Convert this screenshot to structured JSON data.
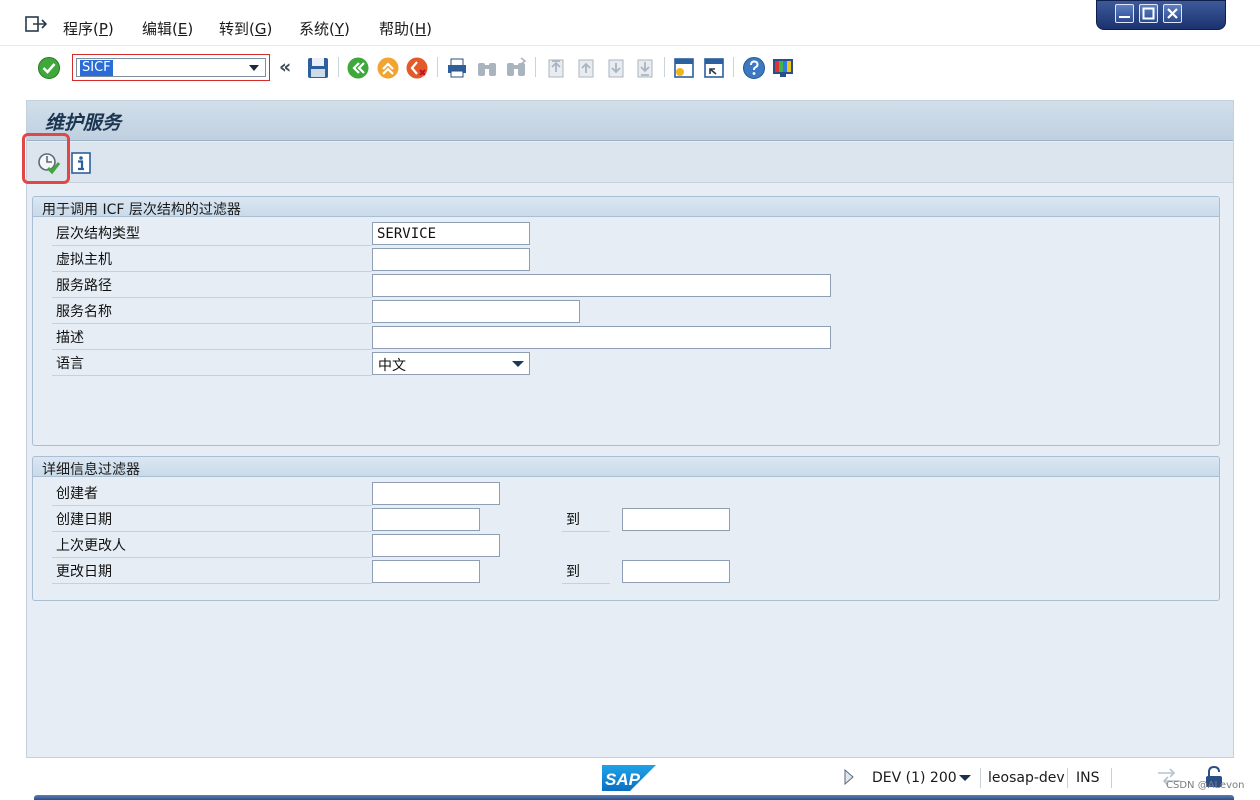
{
  "menu": {
    "items": [
      {
        "label": "程序(",
        "acc": "P",
        "tail": ")"
      },
      {
        "label": "编辑(",
        "acc": "E",
        "tail": ")"
      },
      {
        "label": "转到(",
        "acc": "G",
        "tail": ")"
      },
      {
        "label": "系统(",
        "acc": "Y",
        "tail": ")"
      },
      {
        "label": "帮助(",
        "acc": "H",
        "tail": ")"
      }
    ]
  },
  "toolbar": {
    "command_field_value": "SICF"
  },
  "screen": {
    "title": "维护服务"
  },
  "filter_icf": {
    "title": "用于调用 ICF 层次结构的过滤器",
    "fields": [
      {
        "label": "层次结构类型",
        "value": "SERVICE"
      },
      {
        "label": "虚拟主机",
        "value": ""
      },
      {
        "label": "服务路径",
        "value": ""
      },
      {
        "label": "服务名称",
        "value": ""
      },
      {
        "label": "描述",
        "value": ""
      },
      {
        "label": "语言",
        "value": "中文"
      }
    ]
  },
  "filter_detail": {
    "title": "详细信息过滤器",
    "fields": [
      {
        "label": "创建者",
        "value": ""
      },
      {
        "label": "创建日期",
        "value": "",
        "to_label": "到",
        "to_value": ""
      },
      {
        "label": "上次更改人",
        "value": ""
      },
      {
        "label": "更改日期",
        "value": "",
        "to_label": "到",
        "to_value": ""
      }
    ]
  },
  "status": {
    "system": "DEV (1) 200",
    "server": "leosap-dev",
    "mode": "INS",
    "watermark": "CSDN @ALevon"
  },
  "colors": {
    "highlight": "#e24747",
    "title_text": "#1c3550",
    "panel_bg": "#e6edf4"
  }
}
